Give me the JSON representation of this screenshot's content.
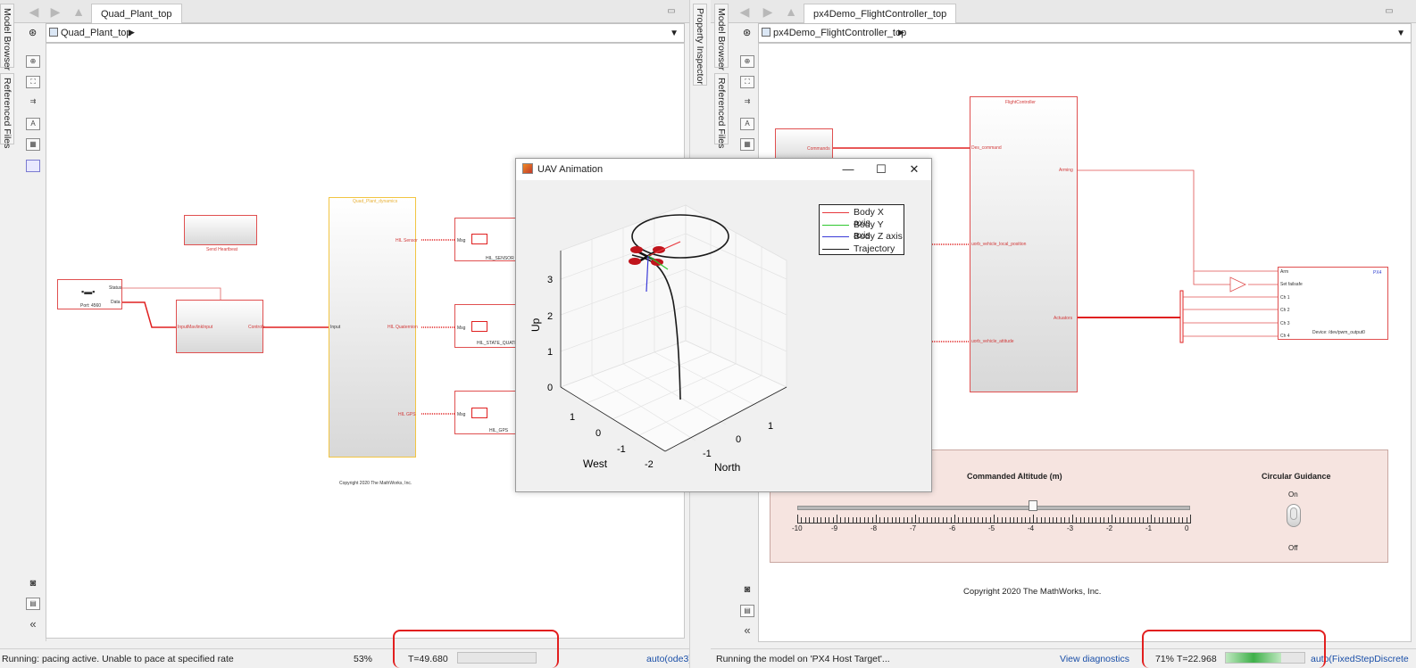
{
  "left_editor": {
    "tab": "Quad_Plant_top",
    "address": "Quad_Plant_top",
    "side_tabs": [
      "Model Browser",
      "Referenced Files"
    ],
    "model": {
      "send_heartbeat": "Send Heartbeat",
      "port_label": "Port: 4560",
      "status_port": "Status",
      "data_port": "Data",
      "input_block_in": "InputMavlinkInput",
      "input_block_out": "Controls",
      "subsystem_title": "Quad_Plant_dynamics",
      "subsystem_in": "Input",
      "hil_sensor_sig": "HIL Sensor",
      "hil_quat_sig": "HIL Quaternion",
      "hil_gps_sig": "HIL GPS",
      "msg": "Msg",
      "hil_sensor": "HIL_SENSOR",
      "hil_state": "HIL_STATE_QUATERNION",
      "hil_gps": "HIL_GPS",
      "copyright": "Copyright 2020 The MathWorks, Inc."
    },
    "status": {
      "message": "Running: pacing active. Unable to pace at specified rate",
      "percent": "53%",
      "time": "T=49.680",
      "progress": 0.0,
      "solver": "auto(ode3)"
    }
  },
  "property_inspector": "Property Inspector",
  "right_editor": {
    "tab": "px4Demo_FlightController_top",
    "address": "px4Demo_FlightController_top",
    "side_tabs": [
      "Model Browser",
      "Referenced Files"
    ],
    "model": {
      "commands": "Commands",
      "fc_title": "FlightController",
      "des_command": "Des_command",
      "arming": "Arming",
      "uorb_pos": "uorb_vehicle_local_position",
      "uorb_att": "uorb_vehicle_attitude",
      "actuators": "Actuators",
      "px4": "PX4",
      "arm": "Arm",
      "set_failsafe": "Set failsafe",
      "ch1": "Ch 1",
      "ch2": "Ch 2",
      "ch3": "Ch 3",
      "ch4": "Ch 4",
      "device": "Device: /dev/pwm_output0",
      "copyright": "Copyright 2020 The MathWorks, Inc."
    },
    "dashboard": {
      "altitude_title": "Commanded Altitude (m)",
      "slider_value": -4,
      "slider_labels": [
        "-10",
        "-9",
        "-8",
        "-7",
        "-6",
        "-5",
        "-4",
        "-3",
        "-2",
        "-1",
        "0"
      ],
      "guidance_title": "Circular Guidance",
      "on": "On",
      "off": "Off"
    },
    "status": {
      "message": "Running the model on 'PX4 Host Target'...",
      "diagnostics": "View diagnostics",
      "percent": "71%",
      "time": "T=22.968",
      "progress": 0.71,
      "solver": "auto(FixedStepDiscrete"
    }
  },
  "uav_window": {
    "title": "UAV Animation",
    "legend": [
      "Body X axis",
      "Body Y axis",
      "Body Z axis",
      "Trajectory"
    ],
    "legend_colors": [
      "#e8383d",
      "#2ec72e",
      "#3a3ad8",
      "#1a1a1a"
    ],
    "z_label": "Up",
    "z_ticks": [
      "0",
      "1",
      "2",
      "3"
    ],
    "west_label": "West",
    "west_ticks": [
      "1",
      "0",
      "-1",
      "-2"
    ],
    "north_label": "North",
    "north_ticks": [
      "-1",
      "0",
      "1"
    ]
  },
  "colors": {
    "accent_red": "#e21f1f",
    "block_red": "#e05050",
    "highlight_orange": "#f2c542"
  }
}
